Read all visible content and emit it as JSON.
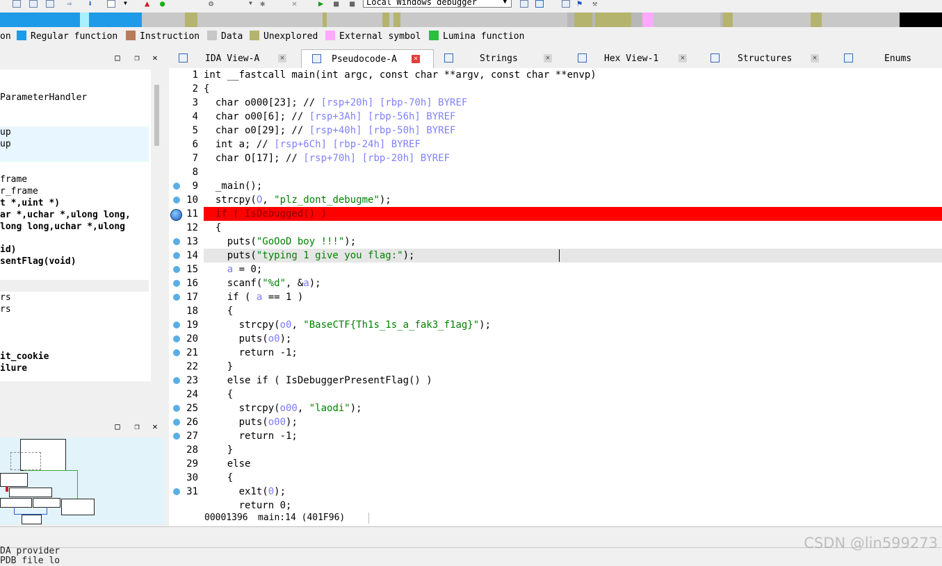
{
  "toolbar": {
    "debugger": "Local Windows debugger",
    "icons": [
      "add-icon",
      "segment-icon",
      "struct-icon",
      "jump-icon",
      "down-arrow-icon",
      "text-icon",
      "warning-icon",
      "green-circle-icon",
      "play-icon",
      "pause-icon",
      "stop-icon",
      "attach-icon",
      "cpu-icon",
      "log-icon",
      "flag-icon"
    ]
  },
  "legend": {
    "partial_first": "on",
    "items": [
      {
        "label": "Regular function",
        "color": "#1d9be8"
      },
      {
        "label": "Instruction",
        "color": "#b97c5a"
      },
      {
        "label": "Data",
        "color": "#c8c8c8"
      },
      {
        "label": "Unexplored",
        "color": "#b4b46e"
      },
      {
        "label": "External symbol",
        "color": "#ffaaff"
      },
      {
        "label": "Lumina function",
        "color": "#2bbf3c"
      }
    ]
  },
  "func_list": [
    "ParameterHandler",
    "up",
    "up",
    "frame",
    "r_frame",
    "t *,uint *)",
    "ar *,uchar *,ulong long,",
    "long long,uchar *,ulong",
    "id)",
    "sentFlag(void)",
    "rs",
    "rs",
    "it_cookie",
    "ilure"
  ],
  "tabs": [
    {
      "label": "IDA View-A",
      "icon": "ida-view-icon"
    },
    {
      "label": "Pseudocode-A",
      "icon": "pseudocode-icon"
    },
    {
      "label": "Strings",
      "icon": "strings-icon"
    },
    {
      "label": "Hex View-1",
      "icon": "hex-view-icon"
    },
    {
      "label": "Structures",
      "icon": "structures-icon"
    },
    {
      "label": "Enums",
      "icon": "enums-icon"
    }
  ],
  "code": {
    "line_numbers": [
      "1",
      "2",
      "3",
      "4",
      "5",
      "6",
      "7",
      "8",
      "9",
      "10",
      "11",
      "12",
      "13",
      "14",
      "15",
      "16",
      "17",
      "18",
      "19",
      "20",
      "21",
      "22",
      "23",
      "24",
      "25",
      "26",
      "27",
      "28",
      "29",
      "30",
      "31"
    ],
    "l1": "int __fastcall main(int argc, const char **argv, const char **envp)",
    "l2": "{",
    "l3a": "  char o000[23]; // ",
    "l3b": "[rsp+20h] [rbp-70h] BYREF",
    "l4a": "  char o00[6]; // ",
    "l4b": "[rsp+3Ah] [rbp-56h] BYREF",
    "l5a": "  char o0[29]; // ",
    "l5b": "[rsp+40h] [rbp-50h] BYREF",
    "l6a": "  int a; // ",
    "l6b": "[rsp+6Ch] [rbp-24h] BYREF",
    "l7a": "  char O[17]; // ",
    "l7b": "[rsp+70h] [rbp-20h] BYREF",
    "l9": "  _main();",
    "l10a": "  strcpy(",
    "l10b": "O",
    "l10c": ", ",
    "l10d": "\"plz_dont_debugme\"",
    "l10e": ");",
    "l11": "  if ( IsDebugged() )",
    "l12": "  {",
    "l13a": "    puts(",
    "l13b": "\"GoOoD boy !!!\"",
    "l13c": ");",
    "l14a": "    puts(",
    "l14b": "\"typing 1 give you flag:\"",
    "l14c": ");",
    "l15a": "    ",
    "l15b": "a",
    "l15c": " = 0;",
    "l16a": "    scanf(",
    "l16b": "\"%d\"",
    "l16c": ", &",
    "l16d": "a",
    "l16e": ");",
    "l17a": "    if ( ",
    "l17b": "a",
    "l17c": " == 1 )",
    "l18": "    {",
    "l19a": "      strcpy(",
    "l19b": "o0",
    "l19c": ", ",
    "l19d": "\"BaseCTF{Th1s_1s_a_fak3_f1ag}\"",
    "l19e": ");",
    "l20a": "      puts(",
    "l20b": "o0",
    "l20c": ");",
    "l21": "      return -1;",
    "l22": "    }",
    "l23": "    else if ( IsDebuggerPresentFlag() )",
    "l24": "    {",
    "l25a": "      strcpy(",
    "l25b": "o00",
    "l25c": ", ",
    "l25d": "\"laodi\"",
    "l25e": ");",
    "l26a": "      puts(",
    "l26b": "o00",
    "l26c": ");",
    "l27": "      return -1;",
    "l28": "    }",
    "l29": "    else",
    "l30": "    {",
    "l31a": "      ex1t(",
    "l31b": "0",
    "l31c": ");",
    "l32": "      return 0;"
  },
  "status": {
    "address": "00001396",
    "location": "main:14 (401F96)"
  },
  "output": {
    "line1": "DA provider",
    "line2": "PDB file lo"
  },
  "watermark": "CSDN @lin599273"
}
